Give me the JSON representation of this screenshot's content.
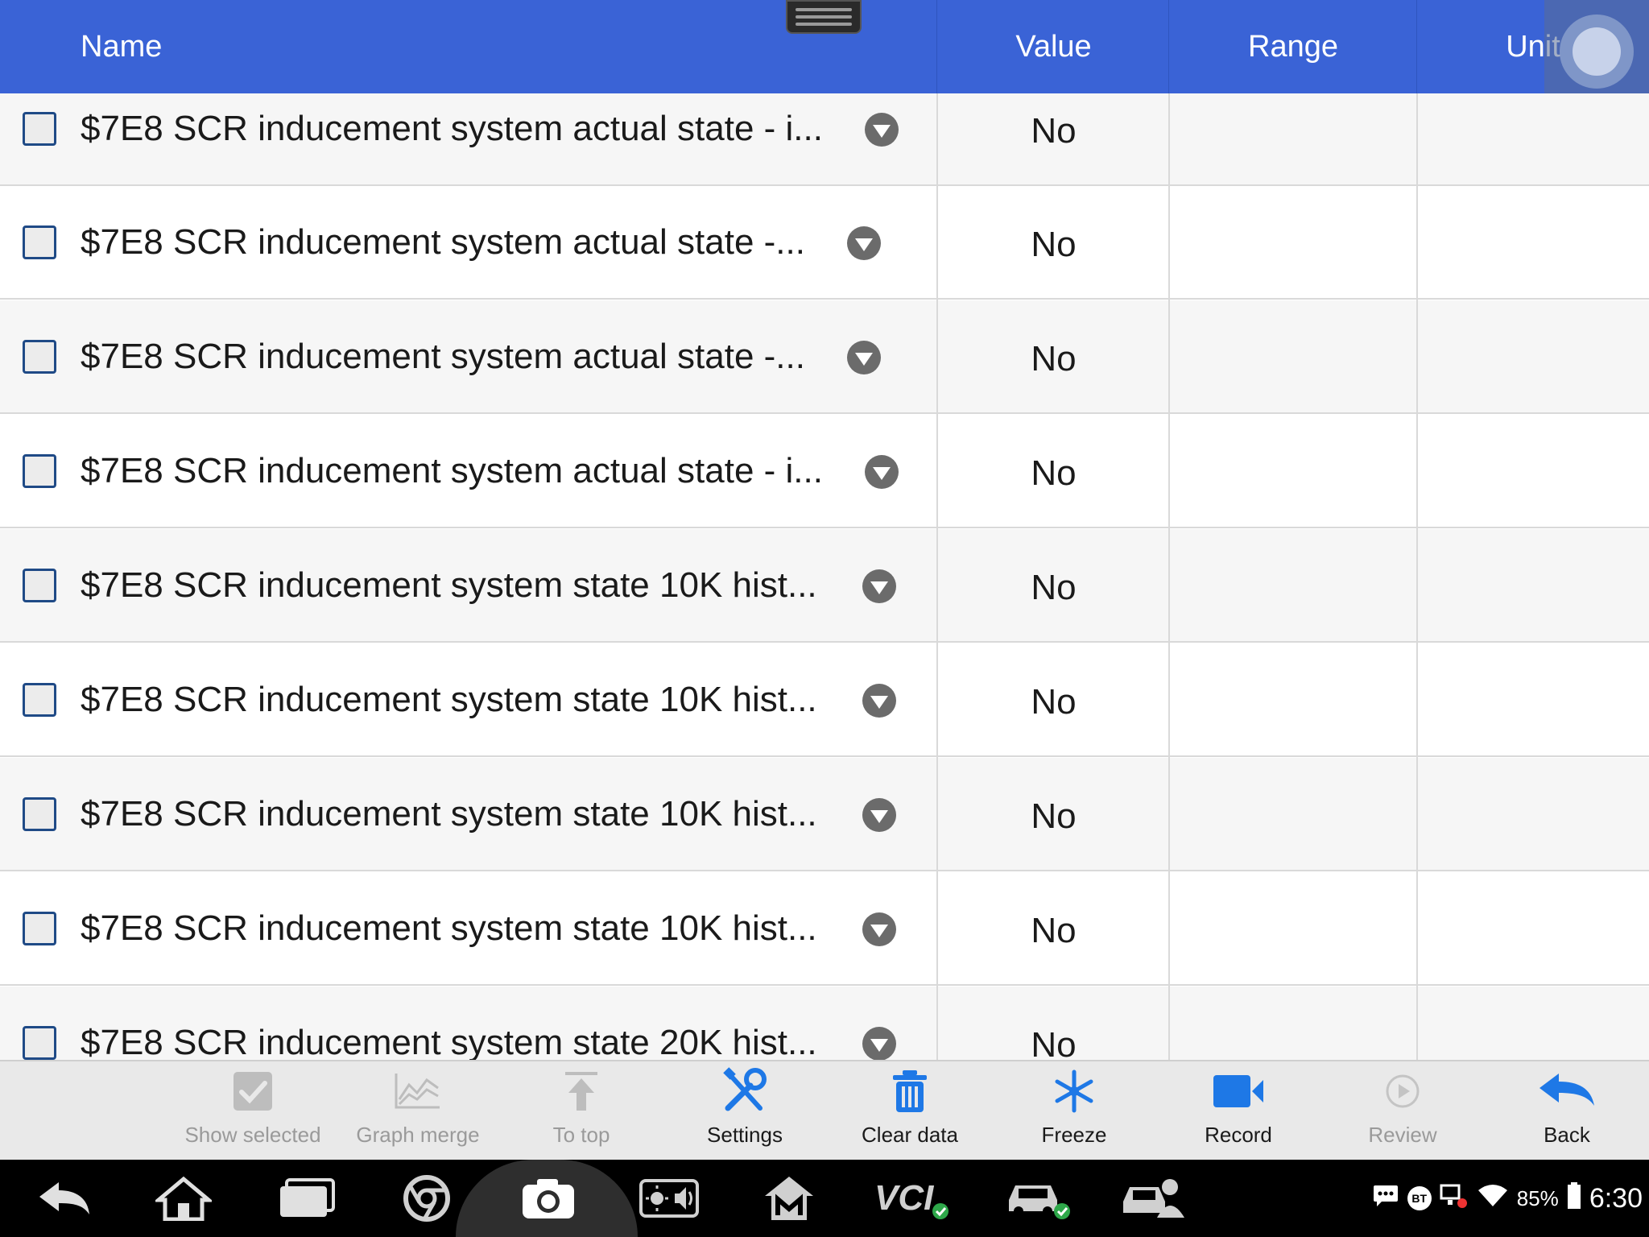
{
  "header": {
    "columns": {
      "name": "Name",
      "value": "Value",
      "range": "Range",
      "unit": "Unit"
    }
  },
  "rows": [
    {
      "name": "$7E8 SCR inducement system actual state - i...",
      "value": "No"
    },
    {
      "name": "$7E8 SCR inducement system actual state -...",
      "value": "No"
    },
    {
      "name": "$7E8 SCR inducement system actual state -...",
      "value": "No"
    },
    {
      "name": "$7E8 SCR inducement system actual state - i...",
      "value": "No"
    },
    {
      "name": "$7E8 SCR inducement system state 10K hist...",
      "value": "No"
    },
    {
      "name": "$7E8 SCR inducement system state 10K hist...",
      "value": "No"
    },
    {
      "name": "$7E8 SCR inducement system state 10K hist...",
      "value": "No"
    },
    {
      "name": "$7E8 SCR inducement system state 10K hist...",
      "value": "No"
    },
    {
      "name": "$7E8 SCR inducement system state 20K hist...",
      "value": "No"
    }
  ],
  "toolbar": {
    "show_selected": "Show selected",
    "graph_merge": "Graph merge",
    "to_top": "To top",
    "settings": "Settings",
    "clear_data": "Clear data",
    "freeze": "Freeze",
    "record": "Record",
    "review": "Review",
    "back": "Back"
  },
  "status_bar": {
    "bt": "BT",
    "battery": "85%",
    "time": "6:30"
  },
  "colors": {
    "header_bg": "#3a63d6",
    "accent_blue": "#1e78e6",
    "checkbox_border": "#1f4a86"
  }
}
